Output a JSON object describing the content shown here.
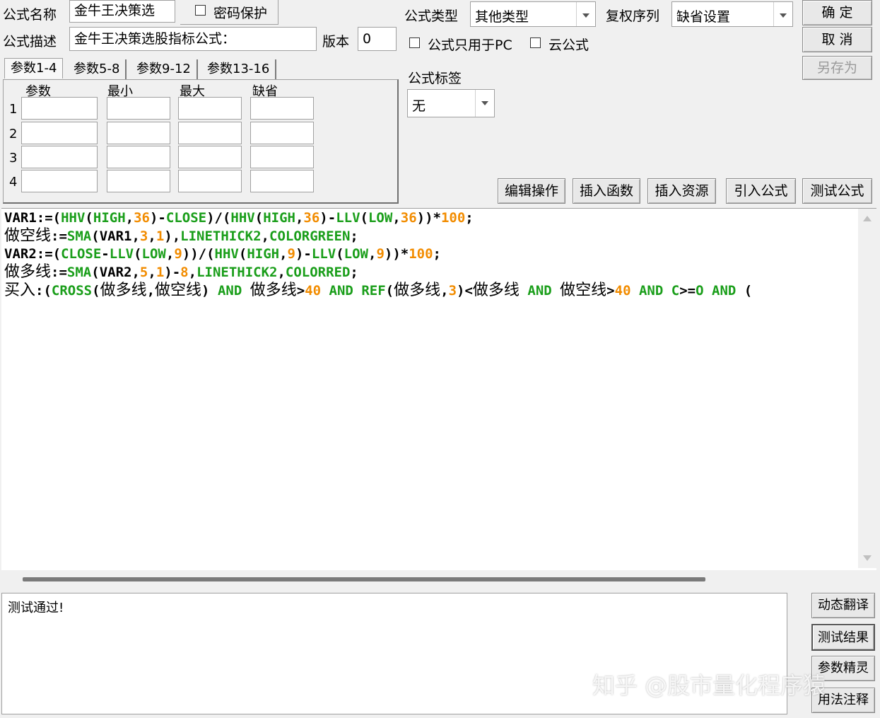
{
  "header": {
    "name_label": "公式名称",
    "name_value": "金牛王决策选",
    "password_label": "密码保护",
    "desc_label": "公式描述",
    "desc_value": "金牛王决策选股指标公式：",
    "version_label": "版本",
    "version_value": "0",
    "type_label": "公式类型",
    "type_value": "其他类型",
    "restore_label": "复权序列",
    "restore_value": "缺省设置",
    "pc_only_label": "公式只用于PC",
    "cloud_label": "云公式",
    "tag_label": "公式标签",
    "tag_value": "无"
  },
  "buttons": {
    "ok": "确 定",
    "cancel": "取 消",
    "save_as": "另存为",
    "edit_ops": "编辑操作",
    "insert_func": "插入函数",
    "insert_res": "插入资源",
    "import_formula": "引入公式",
    "test_formula": "测试公式",
    "dynamic_translate": "动态翻译",
    "test_result": "测试结果",
    "param_wizard": "参数精灵",
    "usage_note": "用法注释"
  },
  "tabs": [
    "参数1-4",
    "参数5-8",
    "参数9-12",
    "参数13-16"
  ],
  "param_headers": [
    "参数",
    "最小",
    "最大",
    "缺省"
  ],
  "param_rows": [
    "1",
    "2",
    "3",
    "4"
  ],
  "code_lines": [
    [
      [
        "k",
        "VAR1"
      ],
      [
        "p",
        ":=("
      ],
      [
        "g",
        "HHV"
      ],
      [
        "p",
        "("
      ],
      [
        "g",
        "HIGH"
      ],
      [
        "p",
        ","
      ],
      [
        "o",
        "36"
      ],
      [
        "p",
        ")-"
      ],
      [
        "g",
        "CLOSE"
      ],
      [
        "p",
        ")/("
      ],
      [
        "g",
        "HHV"
      ],
      [
        "p",
        "("
      ],
      [
        "g",
        "HIGH"
      ],
      [
        "p",
        ","
      ],
      [
        "o",
        "36"
      ],
      [
        "p",
        ")-"
      ],
      [
        "g",
        "LLV"
      ],
      [
        "p",
        "("
      ],
      [
        "g",
        "LOW"
      ],
      [
        "p",
        ","
      ],
      [
        "o",
        "36"
      ],
      [
        "p",
        "))*"
      ],
      [
        "o",
        "100"
      ],
      [
        "p",
        ";"
      ]
    ],
    [
      [
        "c",
        "做空线"
      ],
      [
        "p",
        ":="
      ],
      [
        "g",
        "SMA"
      ],
      [
        "p",
        "("
      ],
      [
        "k",
        "VAR1"
      ],
      [
        "p",
        ","
      ],
      [
        "o",
        "3"
      ],
      [
        "p",
        ","
      ],
      [
        "o",
        "1"
      ],
      [
        "p",
        "),"
      ],
      [
        "g",
        "LINETHICK2"
      ],
      [
        "p",
        ","
      ],
      [
        "g",
        "COLORGREEN"
      ],
      [
        "p",
        ";"
      ]
    ],
    [
      [
        "k",
        "VAR2"
      ],
      [
        "p",
        ":=("
      ],
      [
        "g",
        "CLOSE"
      ],
      [
        "p",
        "-"
      ],
      [
        "g",
        "LLV"
      ],
      [
        "p",
        "("
      ],
      [
        "g",
        "LOW"
      ],
      [
        "p",
        ","
      ],
      [
        "o",
        "9"
      ],
      [
        "p",
        "))/("
      ],
      [
        "g",
        "HHV"
      ],
      [
        "p",
        "("
      ],
      [
        "g",
        "HIGH"
      ],
      [
        "p",
        ","
      ],
      [
        "o",
        "9"
      ],
      [
        "p",
        ")-"
      ],
      [
        "g",
        "LLV"
      ],
      [
        "p",
        "("
      ],
      [
        "g",
        "LOW"
      ],
      [
        "p",
        ","
      ],
      [
        "o",
        "9"
      ],
      [
        "p",
        "))*"
      ],
      [
        "o",
        "100"
      ],
      [
        "p",
        ";"
      ]
    ],
    [
      [
        "c",
        "做多线"
      ],
      [
        "p",
        ":="
      ],
      [
        "g",
        "SMA"
      ],
      [
        "p",
        "("
      ],
      [
        "k",
        "VAR2"
      ],
      [
        "p",
        ","
      ],
      [
        "o",
        "5"
      ],
      [
        "p",
        ","
      ],
      [
        "o",
        "1"
      ],
      [
        "p",
        ")-"
      ],
      [
        "o",
        "8"
      ],
      [
        "p",
        ","
      ],
      [
        "g",
        "LINETHICK2"
      ],
      [
        "p",
        ","
      ],
      [
        "g",
        "COLORRED"
      ],
      [
        "p",
        ";"
      ]
    ],
    [
      [
        "c",
        "买入"
      ],
      [
        "p",
        ":("
      ],
      [
        "g",
        "CROSS"
      ],
      [
        "p",
        "("
      ],
      [
        "c",
        "做多线"
      ],
      [
        "p",
        ","
      ],
      [
        "c",
        "做空线"
      ],
      [
        "p",
        ") "
      ],
      [
        "g",
        "AND"
      ],
      [
        "p",
        " "
      ],
      [
        "c",
        "做多线"
      ],
      [
        "p",
        ">"
      ],
      [
        "o",
        "40"
      ],
      [
        "p",
        " "
      ],
      [
        "g",
        "AND"
      ],
      [
        "p",
        " "
      ],
      [
        "g",
        "REF"
      ],
      [
        "p",
        "("
      ],
      [
        "c",
        "做多线"
      ],
      [
        "p",
        ","
      ],
      [
        "o",
        "3"
      ],
      [
        "p",
        ")<"
      ],
      [
        "c",
        "做多线"
      ],
      [
        "p",
        " "
      ],
      [
        "g",
        "AND"
      ],
      [
        "p",
        " "
      ],
      [
        "c",
        "做空线"
      ],
      [
        "p",
        ">"
      ],
      [
        "o",
        "40"
      ],
      [
        "p",
        " "
      ],
      [
        "g",
        "AND"
      ],
      [
        "p",
        " "
      ],
      [
        "g",
        "C"
      ],
      [
        "p",
        ">="
      ],
      [
        "g",
        "O"
      ],
      [
        "p",
        " "
      ],
      [
        "g",
        "AND"
      ],
      [
        "p",
        " ("
      ]
    ]
  ],
  "output_text": "测试通过!",
  "watermark": "知乎 @股市量化程序猿",
  "colors": {
    "green": "#1a9e1a",
    "orange": "#f28c00",
    "black": "#000000"
  }
}
